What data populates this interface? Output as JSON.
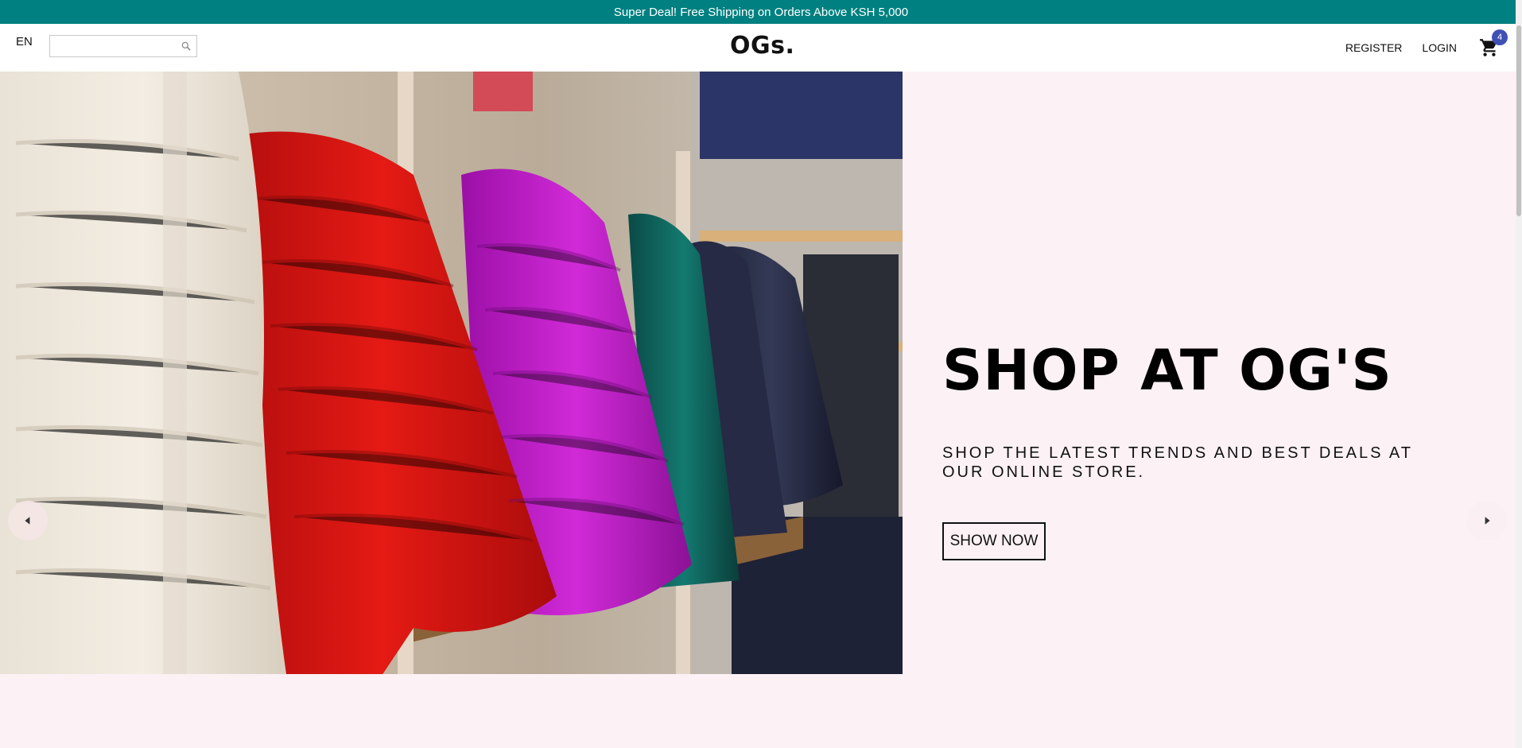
{
  "announcement": {
    "text": "Super Deal! Free Shipping on Orders Above KSH 5,000",
    "background": "#008080"
  },
  "navbar": {
    "language": "EN",
    "search": {
      "value": "",
      "placeholder": "",
      "icon": "search-icon"
    },
    "logo": "OGs.",
    "links": {
      "register": "REGISTER",
      "login": "LOGIN"
    },
    "cart": {
      "icon": "cart-icon",
      "count": "4",
      "badge_color": "#3f51b5"
    }
  },
  "hero": {
    "title": "SHOP AT OG'S",
    "description": "SHOP THE LATEST TRENDS AND BEST DEALS AT OUR ONLINE STORE.",
    "button_label": "SHOW NOW",
    "background": "#fcf1f5",
    "image_alt_icon": "jackets-on-rack-image",
    "prev_icon": "arrow-left-icon",
    "next_icon": "arrow-right-icon"
  }
}
